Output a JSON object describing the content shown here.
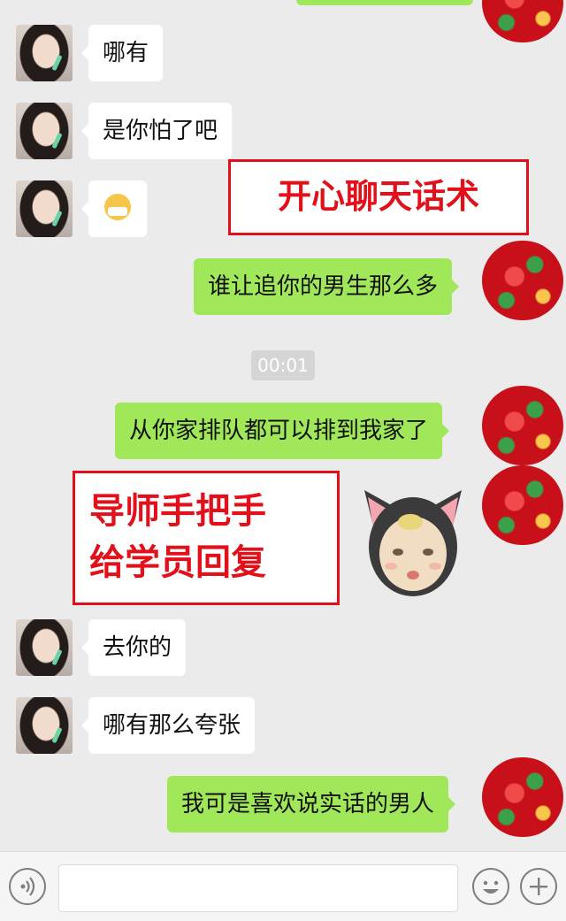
{
  "messages": [
    {
      "side": "left",
      "text": "哪有"
    },
    {
      "side": "left",
      "text": "是你怕了吧"
    },
    {
      "side": "left",
      "text": "",
      "emoji": "mask-face-emoji"
    },
    {
      "side": "right",
      "text": "谁让追你的男生那么多"
    },
    {
      "side": "right",
      "text": "从你家排队都可以排到我家了"
    },
    {
      "side": "right",
      "text": "",
      "sticker": "kitten-hat-baby-sticker"
    },
    {
      "side": "left",
      "text": "去你的"
    },
    {
      "side": "left",
      "text": "哪有那么夸张"
    },
    {
      "side": "right",
      "text": "我可是喜欢说实话的男人"
    }
  ],
  "timestamp": "00:01",
  "overlays": {
    "title": "开心聊天话术",
    "note_line1": "导师手把手",
    "note_line2": "给学员回复"
  },
  "input_bar": {
    "voice_icon": "voice-icon",
    "emoji_icon": "smiley-icon",
    "plus_icon": "plus-icon",
    "input_value": ""
  },
  "colors": {
    "background": "#ebebeb",
    "sent_bubble": "#a0e75a",
    "received_bubble": "#ffffff",
    "annotation_red": "#e2101a"
  }
}
